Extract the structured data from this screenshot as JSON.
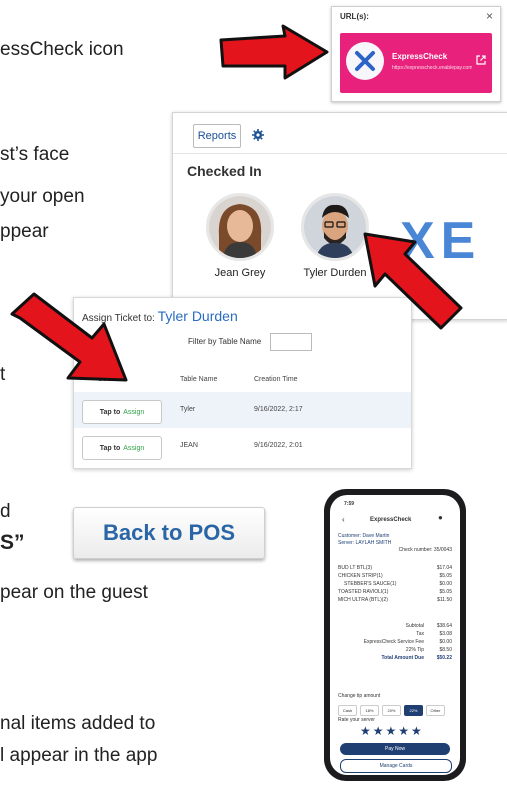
{
  "instructions": [
    {
      "text": "essCheck  icon"
    },
    {
      "text": "st’s face"
    },
    {
      "text": "your open"
    },
    {
      "text": "ppear"
    },
    {
      "text": "t"
    },
    {
      "text": "d"
    },
    {
      "text": "S”"
    },
    {
      "text": "pear on the guest"
    },
    {
      "text": "nal items added to"
    },
    {
      "text": "l appear in the app"
    }
  ],
  "url_card": {
    "title": "URL(s):",
    "close": "×",
    "app_name": "ExpressCheck",
    "app_url": "https://expresscheck.enablepay.com/guest",
    "logo_text": "EXPRESSCHECK"
  },
  "checked_in": {
    "reports_label": "Reports",
    "title": "Checked In",
    "guests": [
      {
        "name": "Jean Grey"
      },
      {
        "name": "Tyler Durden"
      }
    ],
    "watermark": "XE"
  },
  "assign": {
    "label": "Assign Ticket to:",
    "guest_name": "Tyler Durden",
    "filter_label": "Filter by Table Name",
    "columns": [
      "Select",
      "Table Name",
      "Creation Time"
    ],
    "rows": [
      {
        "button": "Tap to",
        "button_accent": "Assign",
        "table": "Tyler",
        "time": "9/16/2022, 2:17"
      },
      {
        "button": "Tap to",
        "button_accent": "Assign",
        "table": "JEAN",
        "time": "9/16/2022, 2:01"
      }
    ]
  },
  "back_button": {
    "label": "Back to POS"
  },
  "phone": {
    "time": "7:59",
    "header": "ExpressCheck",
    "customer": "Customer: Dave Martin",
    "server": "Server: LAYLAH SMITH",
    "check": "Check number: 35/0043",
    "items": [
      {
        "name": "BUD LT BTL(3)",
        "price": "$17.04"
      },
      {
        "name": "CHICKEN STRIP(1)",
        "price": "$5.05"
      },
      {
        "name": "STEBBER'S SAUCE(1)",
        "price": "$0.00"
      },
      {
        "name": "TOASTED RAVIOLI(1)",
        "price": "$5.05"
      },
      {
        "name": "MICH ULTRA (BTL)(2)",
        "price": "$11.50"
      }
    ],
    "totals": [
      {
        "label": "Subtotal",
        "value": "$38.64"
      },
      {
        "label": "Tax",
        "value": "$3.08"
      },
      {
        "label": "ExpressCheck Service Fee",
        "value": "$0.00"
      },
      {
        "label": "22% Tip",
        "value": "$8.50"
      },
      {
        "label": "Total Amount Due",
        "value": "$50.22"
      }
    ],
    "tip_label": "Change tip amount",
    "tips": [
      "Cash",
      "18%",
      "20%",
      "22%",
      "Other"
    ],
    "rate_label": "Rate your server",
    "stars": "★★★★★",
    "pay_label": "Pay Now",
    "cards_label": "Manage Cards"
  },
  "colors": {
    "arrow_red": "#e3141b",
    "brand_pink": "#e8227c",
    "brand_blue": "#1f3f73"
  }
}
